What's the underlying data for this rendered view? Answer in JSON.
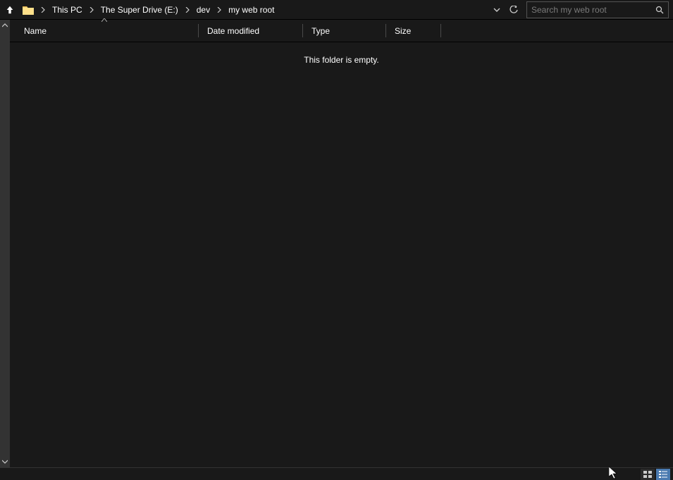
{
  "breadcrumbs": [
    {
      "label": "This PC"
    },
    {
      "label": "The Super Drive (E:)"
    },
    {
      "label": "dev"
    },
    {
      "label": "my web root"
    }
  ],
  "search": {
    "placeholder": "Search my web root"
  },
  "columns": {
    "name": "Name",
    "date": "Date modified",
    "type": "Type",
    "size": "Size"
  },
  "empty_message": "This folder is empty."
}
